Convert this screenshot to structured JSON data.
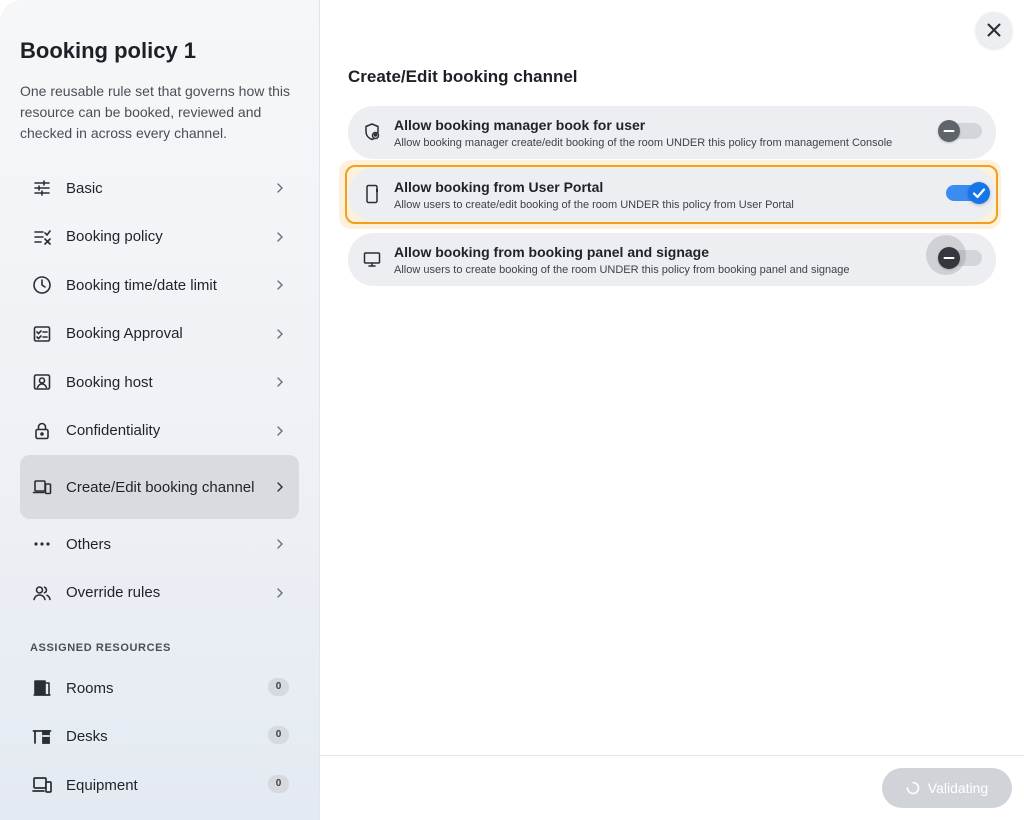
{
  "sidebar": {
    "title": "Booking policy 1",
    "description": "One reusable rule set that governs how this resource can be booked, reviewed and checked in across every channel.",
    "items": [
      {
        "label": "Basic",
        "icon": "sliders-icon"
      },
      {
        "label": "Booking policy",
        "icon": "checklist-icon"
      },
      {
        "label": "Booking time/date limit",
        "icon": "clock-icon"
      },
      {
        "label": "Booking Approval",
        "icon": "approval-icon"
      },
      {
        "label": "Booking host",
        "icon": "host-icon"
      },
      {
        "label": "Confidentiality",
        "icon": "lock-icon"
      },
      {
        "label": "Create/Edit booking channel",
        "icon": "devices-icon",
        "active": true
      },
      {
        "label": "Others",
        "icon": "more-icon"
      },
      {
        "label": "Override rules",
        "icon": "users-icon"
      }
    ],
    "assigned_title": "ASSIGNED RESOURCES",
    "resources": [
      {
        "label": "Rooms",
        "count": "0",
        "icon": "door-icon"
      },
      {
        "label": "Desks",
        "count": "0",
        "icon": "desk-icon"
      },
      {
        "label": "Equipment",
        "count": "0",
        "icon": "equipment-icon"
      }
    ]
  },
  "main": {
    "title": "Create/Edit booking channel",
    "rows": [
      {
        "title": "Allow booking manager book for user",
        "subtitle": "Allow booking manager create/edit booking of the room UNDER this policy from management Console",
        "enabled": false,
        "icon": "shield-user-icon"
      },
      {
        "title": "Allow booking from User Portal",
        "subtitle": "Allow users to create/edit booking of the room UNDER this policy from User Portal",
        "enabled": true,
        "icon": "phone-icon"
      },
      {
        "title": "Allow booking from booking panel and signage",
        "subtitle": "Allow users to create booking of the room UNDER this policy from booking panel and signage",
        "enabled": false,
        "icon": "monitor-icon"
      }
    ]
  },
  "footer": {
    "validate_label": "Validating"
  },
  "colors": {
    "accent": "#1676e8",
    "highlight": "#f0a020"
  }
}
